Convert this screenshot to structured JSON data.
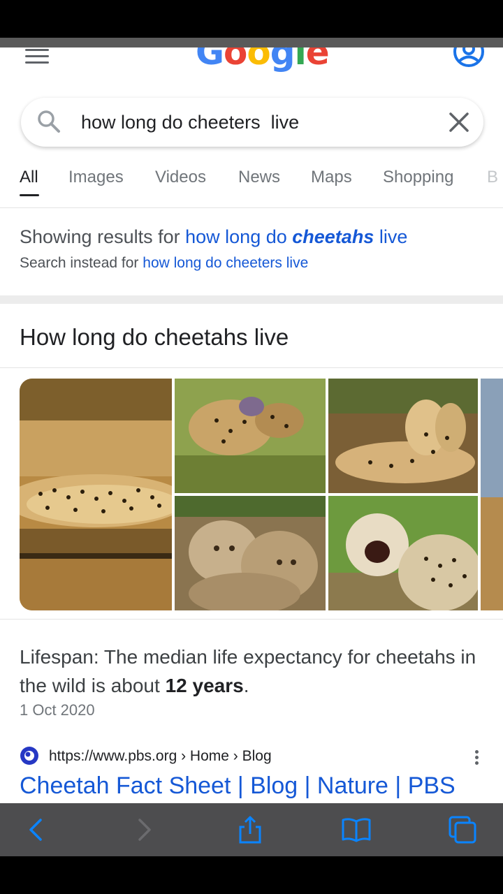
{
  "header": {
    "logo_text": "Google",
    "menu_icon": "hamburger-menu-icon",
    "account_icon": "account-circle-icon"
  },
  "search": {
    "value": "how long do cheeters  live",
    "search_icon": "search-icon",
    "clear_icon": "close-icon"
  },
  "tabs": [
    {
      "label": "All",
      "active": true
    },
    {
      "label": "Images"
    },
    {
      "label": "Videos"
    },
    {
      "label": "News"
    },
    {
      "label": "Maps"
    },
    {
      "label": "Shopping"
    },
    {
      "label": "B"
    }
  ],
  "spelling": {
    "showing_prefix": "Showing results for",
    "corrected_pre": "how long do",
    "corrected_bold": "cheetahs",
    "corrected_post": "live",
    "instead_prefix": "Search instead for",
    "instead_query": "how long do cheeters live"
  },
  "card": {
    "title": "How long do cheetahs live"
  },
  "answer": {
    "text_pre": "Lifespan: The median life expectancy for cheetahs in the wild is about",
    "text_bold": "12 years",
    "text_post": ".",
    "date": "1 Oct 2020"
  },
  "result": {
    "cite": "https://www.pbs.org › Home › Blog",
    "title": "Cheetah Fact Sheet | Blog | Nature | PBS"
  },
  "toolbar": {
    "back_icon": "back-chevron-icon",
    "forward_icon": "forward-chevron-icon",
    "share_icon": "share-icon",
    "bookmarks_icon": "book-icon",
    "tabs_icon": "tabs-icon"
  },
  "colors": {
    "link": "#1558d6",
    "toolbar_bg": "#4d4d4f",
    "toolbar_icon": "#0a84ff"
  }
}
